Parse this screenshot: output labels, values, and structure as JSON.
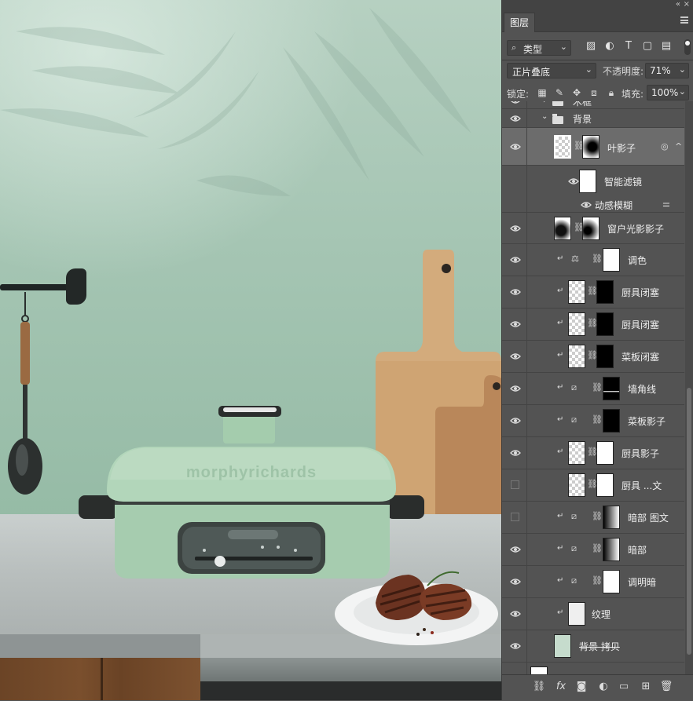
{
  "panel": {
    "tab_label": "图层",
    "filter_kind": "类型",
    "blend_mode": "正片叠底",
    "opacity_label": "不透明度:",
    "opacity_value": "71%",
    "lock_label": "锁定:",
    "fill_label": "填充:",
    "fill_value": "100%",
    "partial_top_layer": "木框",
    "group_name": "背景",
    "layers": [
      {
        "name": "叶影子",
        "selected": true
      },
      {
        "name": "智能滤镜"
      },
      {
        "name": "动感模糊"
      },
      {
        "name": "窗户光影影子"
      },
      {
        "name": "调色"
      },
      {
        "name": "厨具闭塞"
      },
      {
        "name": "厨具闭塞"
      },
      {
        "name": "菜板闭塞"
      },
      {
        "name": "墙角线"
      },
      {
        "name": "菜板影子"
      },
      {
        "name": "厨具影子"
      },
      {
        "name": "厨具 ...文",
        "hidden": true
      },
      {
        "name": "暗部 图文",
        "hidden": true
      },
      {
        "name": "暗部"
      },
      {
        "name": "调明暗"
      },
      {
        "name": "纹理"
      },
      {
        "name": "背景 拷贝"
      }
    ]
  },
  "canvas": {
    "brand_text": "morphyrichards"
  },
  "icons": {
    "eye": "eye-icon",
    "link": "chain-link-icon",
    "clip": "clipping-arrow-icon",
    "folder": "folder-icon",
    "fx": "fx-icon",
    "trash": "trash-icon"
  },
  "colors": {
    "panel_bg": "#535353",
    "panel_dark": "#434343",
    "selection": "#6c6c6c",
    "wall_green": "#a5c5b3",
    "appliance_green": "#a8cdb1"
  }
}
